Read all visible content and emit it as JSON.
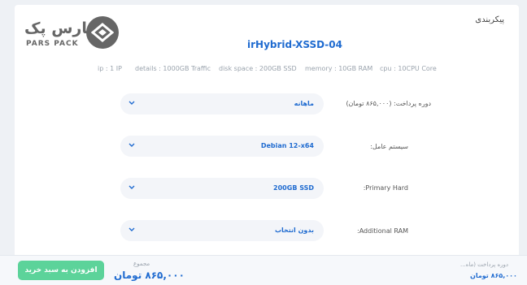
{
  "section": {
    "title": "پیکربندی"
  },
  "logo": {
    "text_fa": "پارس پک",
    "text_en": "PARS PACK"
  },
  "product": {
    "name": "irHybrid-XSSD-04"
  },
  "specs": {
    "ip": "ip : 1 IP",
    "details": "details : 1000GB Traffic",
    "disk": "disk space : 200GB SSD",
    "memory": "memory : 10GB RAM",
    "cpu": "cpu : 10CPU Core"
  },
  "options": [
    {
      "label": "دوره پرداخت: (۸۶۵,۰۰۰ تومان)",
      "value": "ماهانه",
      "icon": "chevron-down-icon"
    },
    {
      "label": "سیستم عامل:",
      "value": "Debian 12-x64",
      "icon": "chevron-down-icon"
    },
    {
      "label": "Primary Hard:",
      "value": "200GB SSD",
      "icon": "chevron-down-icon"
    },
    {
      "label": "Additional RAM:",
      "value": "بدون انتخاب",
      "icon": "chevron-down-icon"
    }
  ],
  "footer": {
    "add_button": "افزودن به سبد خرید",
    "total_label": "مجموع",
    "total_amount": "۸۶۵,۰۰۰ تومان",
    "period_label": "دوره پرداخت (ماه...",
    "period_amount": "۸۶۵,۰۰۰ تومان"
  },
  "colors": {
    "accent": "#1f6bd0",
    "button": "#5cd39a",
    "background": "#eef1f5"
  }
}
